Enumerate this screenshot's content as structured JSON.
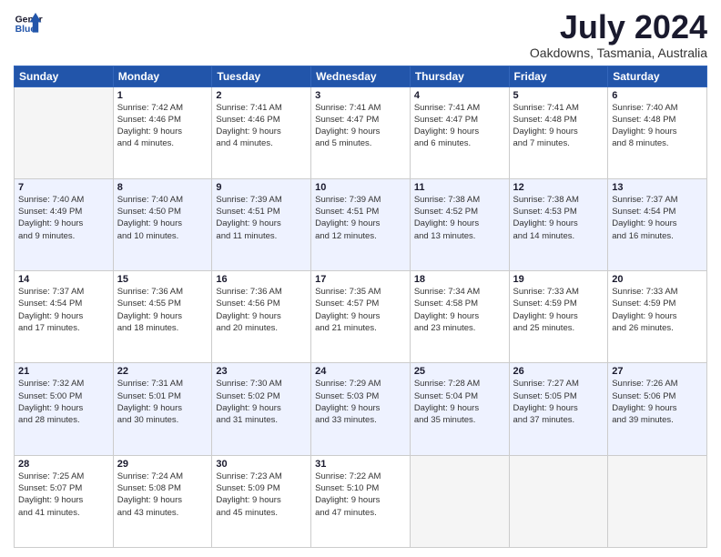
{
  "header": {
    "logo_line1": "General",
    "logo_line2": "Blue",
    "month": "July 2024",
    "location": "Oakdowns, Tasmania, Australia"
  },
  "weekdays": [
    "Sunday",
    "Monday",
    "Tuesday",
    "Wednesday",
    "Thursday",
    "Friday",
    "Saturday"
  ],
  "weeks": [
    [
      {
        "day": "",
        "info": ""
      },
      {
        "day": "1",
        "info": "Sunrise: 7:42 AM\nSunset: 4:46 PM\nDaylight: 9 hours\nand 4 minutes."
      },
      {
        "day": "2",
        "info": "Sunrise: 7:41 AM\nSunset: 4:46 PM\nDaylight: 9 hours\nand 4 minutes."
      },
      {
        "day": "3",
        "info": "Sunrise: 7:41 AM\nSunset: 4:47 PM\nDaylight: 9 hours\nand 5 minutes."
      },
      {
        "day": "4",
        "info": "Sunrise: 7:41 AM\nSunset: 4:47 PM\nDaylight: 9 hours\nand 6 minutes."
      },
      {
        "day": "5",
        "info": "Sunrise: 7:41 AM\nSunset: 4:48 PM\nDaylight: 9 hours\nand 7 minutes."
      },
      {
        "day": "6",
        "info": "Sunrise: 7:40 AM\nSunset: 4:48 PM\nDaylight: 9 hours\nand 8 minutes."
      }
    ],
    [
      {
        "day": "7",
        "info": "Sunrise: 7:40 AM\nSunset: 4:49 PM\nDaylight: 9 hours\nand 9 minutes."
      },
      {
        "day": "8",
        "info": "Sunrise: 7:40 AM\nSunset: 4:50 PM\nDaylight: 9 hours\nand 10 minutes."
      },
      {
        "day": "9",
        "info": "Sunrise: 7:39 AM\nSunset: 4:51 PM\nDaylight: 9 hours\nand 11 minutes."
      },
      {
        "day": "10",
        "info": "Sunrise: 7:39 AM\nSunset: 4:51 PM\nDaylight: 9 hours\nand 12 minutes."
      },
      {
        "day": "11",
        "info": "Sunrise: 7:38 AM\nSunset: 4:52 PM\nDaylight: 9 hours\nand 13 minutes."
      },
      {
        "day": "12",
        "info": "Sunrise: 7:38 AM\nSunset: 4:53 PM\nDaylight: 9 hours\nand 14 minutes."
      },
      {
        "day": "13",
        "info": "Sunrise: 7:37 AM\nSunset: 4:54 PM\nDaylight: 9 hours\nand 16 minutes."
      }
    ],
    [
      {
        "day": "14",
        "info": "Sunrise: 7:37 AM\nSunset: 4:54 PM\nDaylight: 9 hours\nand 17 minutes."
      },
      {
        "day": "15",
        "info": "Sunrise: 7:36 AM\nSunset: 4:55 PM\nDaylight: 9 hours\nand 18 minutes."
      },
      {
        "day": "16",
        "info": "Sunrise: 7:36 AM\nSunset: 4:56 PM\nDaylight: 9 hours\nand 20 minutes."
      },
      {
        "day": "17",
        "info": "Sunrise: 7:35 AM\nSunset: 4:57 PM\nDaylight: 9 hours\nand 21 minutes."
      },
      {
        "day": "18",
        "info": "Sunrise: 7:34 AM\nSunset: 4:58 PM\nDaylight: 9 hours\nand 23 minutes."
      },
      {
        "day": "19",
        "info": "Sunrise: 7:33 AM\nSunset: 4:59 PM\nDaylight: 9 hours\nand 25 minutes."
      },
      {
        "day": "20",
        "info": "Sunrise: 7:33 AM\nSunset: 4:59 PM\nDaylight: 9 hours\nand 26 minutes."
      }
    ],
    [
      {
        "day": "21",
        "info": "Sunrise: 7:32 AM\nSunset: 5:00 PM\nDaylight: 9 hours\nand 28 minutes."
      },
      {
        "day": "22",
        "info": "Sunrise: 7:31 AM\nSunset: 5:01 PM\nDaylight: 9 hours\nand 30 minutes."
      },
      {
        "day": "23",
        "info": "Sunrise: 7:30 AM\nSunset: 5:02 PM\nDaylight: 9 hours\nand 31 minutes."
      },
      {
        "day": "24",
        "info": "Sunrise: 7:29 AM\nSunset: 5:03 PM\nDaylight: 9 hours\nand 33 minutes."
      },
      {
        "day": "25",
        "info": "Sunrise: 7:28 AM\nSunset: 5:04 PM\nDaylight: 9 hours\nand 35 minutes."
      },
      {
        "day": "26",
        "info": "Sunrise: 7:27 AM\nSunset: 5:05 PM\nDaylight: 9 hours\nand 37 minutes."
      },
      {
        "day": "27",
        "info": "Sunrise: 7:26 AM\nSunset: 5:06 PM\nDaylight: 9 hours\nand 39 minutes."
      }
    ],
    [
      {
        "day": "28",
        "info": "Sunrise: 7:25 AM\nSunset: 5:07 PM\nDaylight: 9 hours\nand 41 minutes."
      },
      {
        "day": "29",
        "info": "Sunrise: 7:24 AM\nSunset: 5:08 PM\nDaylight: 9 hours\nand 43 minutes."
      },
      {
        "day": "30",
        "info": "Sunrise: 7:23 AM\nSunset: 5:09 PM\nDaylight: 9 hours\nand 45 minutes."
      },
      {
        "day": "31",
        "info": "Sunrise: 7:22 AM\nSunset: 5:10 PM\nDaylight: 9 hours\nand 47 minutes."
      },
      {
        "day": "",
        "info": ""
      },
      {
        "day": "",
        "info": ""
      },
      {
        "day": "",
        "info": ""
      }
    ]
  ]
}
